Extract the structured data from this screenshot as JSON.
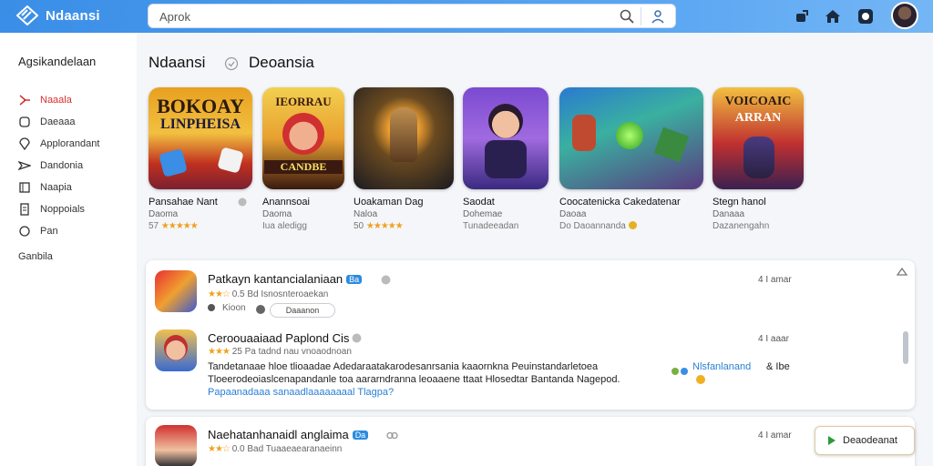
{
  "header": {
    "brand": "Ndaansi",
    "search_value": "Aprok",
    "colors": {
      "bar": "#3a8ee6",
      "accent": "#d63030",
      "link": "#2a7fd4",
      "star": "#f0a020"
    }
  },
  "sidebar": {
    "title": "Agsikandelaan",
    "items": [
      {
        "label": "Naaala",
        "icon": "bell-icon",
        "active": true
      },
      {
        "label": "Daeaaa",
        "icon": "message-icon",
        "active": false
      },
      {
        "label": "Applorandant",
        "icon": "location-icon",
        "active": false
      },
      {
        "label": "Dandonia",
        "icon": "send-icon",
        "active": false
      },
      {
        "label": "Naapia",
        "icon": "book-icon",
        "active": false
      },
      {
        "label": "Noppoials",
        "icon": "document-icon",
        "active": false
      },
      {
        "label": "Pan",
        "icon": "circle-icon",
        "active": false
      }
    ],
    "extra": "Ganbila"
  },
  "section": {
    "title": "Ndaansi",
    "subtitle": "Deoansia"
  },
  "cards": [
    {
      "name": "Pansahae Nant",
      "dev": "Daoma",
      "meta": "57",
      "stars": "★★★★★",
      "art_top": "BOKOAY",
      "art_mid": "LINPHEISA"
    },
    {
      "name": "Anannsoai",
      "dev": "Daoma",
      "meta": "Iua aledigg",
      "stars": "",
      "art_top": "IEORRAU",
      "art_mid": "CANDBE"
    },
    {
      "name": "Uoakaman Dag",
      "dev": "Naloa",
      "meta": "50",
      "stars": "★★★★★",
      "art_top": "",
      "art_mid": ""
    },
    {
      "name": "Saodat",
      "dev": "Dohemae",
      "meta": "Tunadeeadan",
      "stars": "",
      "art_top": "",
      "art_mid": ""
    },
    {
      "name": "Coocatenicka  Cakedatenar",
      "dev": "Daoaa",
      "meta": "Do Daoannanda",
      "stars": "",
      "art_top": "",
      "art_mid": ""
    },
    {
      "name": "Stegn hanol",
      "dev": "Danaaa",
      "meta": "Dazanengahn",
      "stars": "",
      "art_top": "VOICOAIC",
      "art_mid": "ARRAN"
    }
  ],
  "list": [
    {
      "title": "Patkayn kantancialaniaan",
      "badge": "Ba",
      "rating": "0.5",
      "sub": "Bd Isnosnteroaekan",
      "time": "4 I amar",
      "pill_label": "Kioon",
      "pill2_label": "Daaanon"
    },
    {
      "title": "Ceroouaaiaad Paplond Cis",
      "rating": "25",
      "sub": "Pa tadnd nau vnoaodnoan",
      "time": "4 I aaar",
      "desc1": "Tandetanaae hloe tlioaadae Adedaraatakarodesanrsania kaaornkna Peuinstandarletoea",
      "desc1_link": "Nlsfanlanand",
      "desc1_end": "& Ibe",
      "desc2": "Tloeerodeoiaslcenapandanle toa aararndranna leoaaene ttaat Hlosedtar Bantanda Nagepod.",
      "desc3": "Papaanadaaa sanaadlaaaaaaaal  Tlagpa?"
    },
    {
      "title": "Naehatanhanaidl anglaima",
      "badge": "Da",
      "rating": "0.0",
      "sub": "Bad Tuaaeaearanaeinn",
      "time": "4 I amar",
      "action": "Deaodeanat"
    }
  ]
}
